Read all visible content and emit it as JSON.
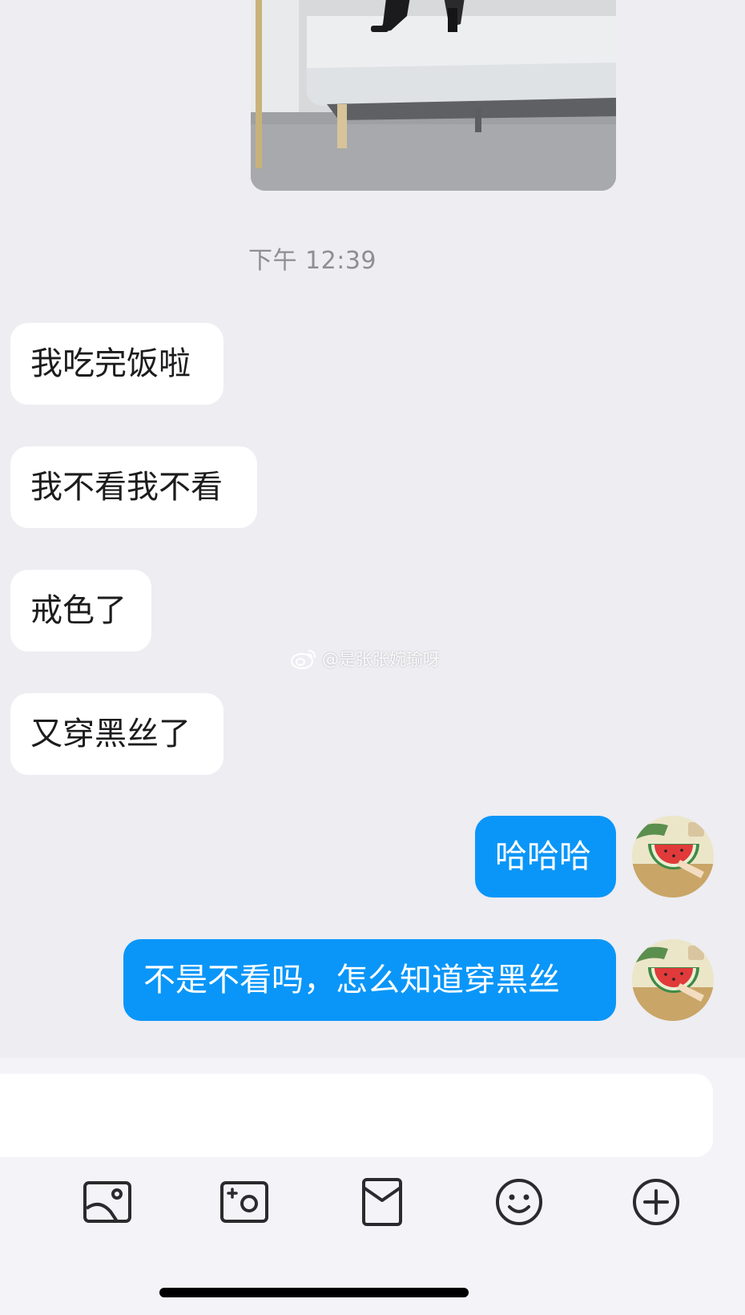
{
  "chat": {
    "timestamp": "下午 12:39",
    "messages": [
      {
        "side": "incoming",
        "text": "我吃完饭啦"
      },
      {
        "side": "incoming",
        "text": "我不看我不看"
      },
      {
        "side": "incoming",
        "text": "戒色了"
      },
      {
        "side": "incoming",
        "text": "又穿黑丝了"
      },
      {
        "side": "outgoing",
        "text": "哈哈哈"
      },
      {
        "side": "outgoing",
        "text": "不是不看吗，怎么知道穿黑丝"
      }
    ]
  },
  "watermark": {
    "text": "@是张张婉瑜呀",
    "icon": "weibo-icon"
  },
  "composer": {
    "input_value": "",
    "tools": [
      "photo-album-icon",
      "camera-icon",
      "red-packet-icon",
      "emoji-icon",
      "plus-circle-icon"
    ]
  },
  "colors": {
    "background": "#ededf2",
    "outgoing_bubble": "#0a96f8",
    "incoming_bubble": "#ffffff",
    "timestamp": "#8e8e93"
  }
}
